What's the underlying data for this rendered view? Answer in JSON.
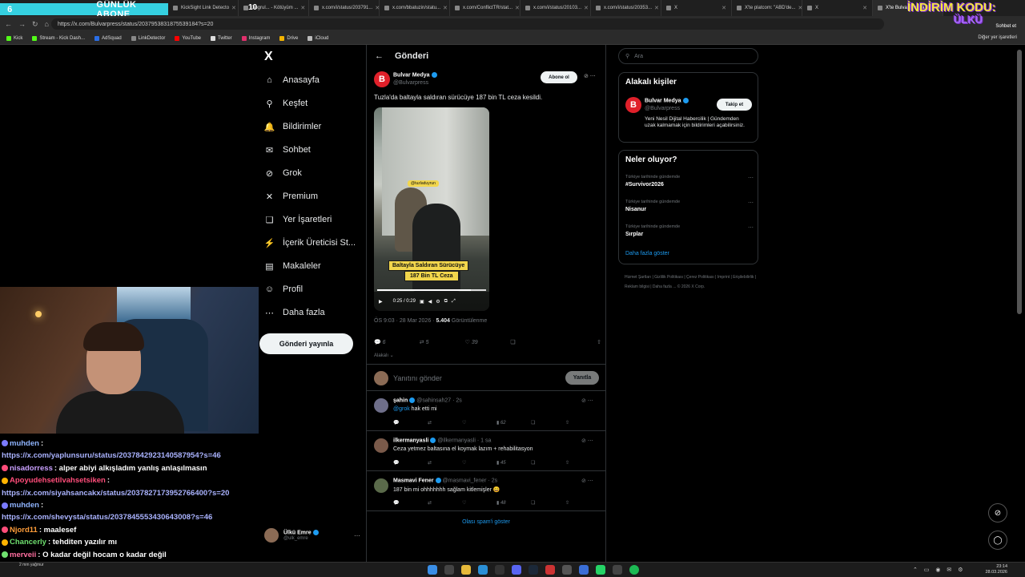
{
  "browser": {
    "tabs": [
      {
        "label": "KickSight Link Detecto",
        "active": false
      },
      {
        "label": "Dogrul... - Kötüyüm ...",
        "active": false
      },
      {
        "label": "x.com/i/status/203791...",
        "active": false
      },
      {
        "label": "x.com/bbatuzin/statu...",
        "active": false
      },
      {
        "label": "x.com/ConflictTR/stat...",
        "active": false
      },
      {
        "label": "x.com/i/status/20103...",
        "active": false
      },
      {
        "label": "x.com/i/status/20353...",
        "active": false
      },
      {
        "label": "X",
        "active": false
      },
      {
        "label": "X'te platcom: \"ABD'de...",
        "active": false
      },
      {
        "label": "X",
        "active": false
      },
      {
        "label": "X'te Bulvar Medya: \"T...",
        "active": true
      }
    ],
    "url": "https://x.com/Bulvarpress/status/2037953831875539184?s=20",
    "bookmarks": [
      "Kick",
      "Stream - Kick Dash...",
      "AdSquad",
      "LinkDetector",
      "YouTube",
      "Twitter",
      "Instagram",
      "Drive",
      "iCloud"
    ],
    "other_bookmarks": "Diğer yer işaretleri"
  },
  "overlay": {
    "counter_left": "6",
    "banner": "GÜNLÜK ABONE",
    "counter_right": "10",
    "promo_line1": "İNDİRİM KODU:",
    "promo_line2": "ÜLKÜ",
    "chat_label": "Sohbet et"
  },
  "nav": {
    "logo": "X",
    "items": [
      {
        "label": "Anasayfa",
        "icon": "home-icon",
        "glyph": "⌂"
      },
      {
        "label": "Keşfet",
        "icon": "search-icon",
        "glyph": "⚲"
      },
      {
        "label": "Bildirimler",
        "icon": "bell-icon",
        "glyph": "🔔"
      },
      {
        "label": "Sohbet",
        "icon": "mail-icon",
        "glyph": "✉"
      },
      {
        "label": "Grok",
        "icon": "grok-icon",
        "glyph": "⊘"
      },
      {
        "label": "Premium",
        "icon": "x-premium-icon",
        "glyph": "✕"
      },
      {
        "label": "Yer İşaretleri",
        "icon": "bookmark-icon",
        "glyph": "❏"
      },
      {
        "label": "İçerik Üreticisi St...",
        "icon": "lightning-icon",
        "glyph": "⚡"
      },
      {
        "label": "Makaleler",
        "icon": "article-icon",
        "glyph": "▤"
      },
      {
        "label": "Profil",
        "icon": "profile-icon",
        "glyph": "☺"
      },
      {
        "label": "Daha fazla",
        "icon": "more-icon",
        "glyph": "⋯"
      }
    ],
    "post_button": "Gönderi yayınla",
    "me": {
      "name": "Ülkü Emre",
      "handle": "@ulk_emre"
    }
  },
  "post": {
    "header": "Gönderi",
    "author_name": "Bulvar Medya",
    "author_handle": "@Bulvarpress",
    "subscribe": "Abone ol",
    "text": "Tuzla'da baltayla saldıran sürücüye 187 bin TL ceza kesildi.",
    "video": {
      "tag": "@tuzladuyrun",
      "caption1": "Baltayla Saldıran Sürücüye",
      "caption2": "187 Bin TL Ceza",
      "time": "0:25 / 0:29",
      "progress": 0.86
    },
    "time": "ÖS 9:03 · 28 Mar 2026 · ",
    "views": "5.404",
    "views_label": " Görüntülenme",
    "counts": {
      "replies": "6",
      "reposts": "5",
      "likes": "39"
    },
    "related": "Alakalı ⌄",
    "reply_placeholder": "Yanıtını gönder",
    "reply_button": "Yanıtla",
    "comments": [
      {
        "name": "şahin",
        "handle": "@sahinsah27 · 2s",
        "mention": "@grok",
        "text": " hak etti mi",
        "views": "62",
        "avatar": "#6f6f8a"
      },
      {
        "name": "ilkermanyasli",
        "handle": "@ilkermanyasli · 1 sa",
        "mention": "",
        "text": "Ceza yetmez baltasına el koymak lazım + rehabilitasyon",
        "views": "45",
        "avatar": "#7a5a4a"
      },
      {
        "name": "Masmavi Fener",
        "handle": "@masmavi_fener · 2s",
        "mention": "",
        "text": "187 bin mi ohhhhhhh sağlam kitlemişler 😄",
        "views": "48",
        "avatar": "#5a6a4a"
      }
    ],
    "show_spam": "Olası spam'i göster"
  },
  "sidebar": {
    "search_placeholder": "Ara",
    "related_title": "Alakalı kişiler",
    "person": {
      "name": "Bulvar Medya",
      "handle": "@Bulvarpress",
      "follow": "Takip et",
      "bio": "Yeni Nesil Dijital Habercilik | Gündemden uzak kalmamak için bildirimleri açabilirsiniz."
    },
    "trends_title": "Neler oluyor?",
    "trends": [
      {
        "context": "Türkiye tarihinde gündemde",
        "title": "#Survivor2026"
      },
      {
        "context": "Türkiye tarihinde gündemde",
        "title": "Nisanur"
      },
      {
        "context": "Türkiye tarihinde gündemde",
        "title": "Sırplar"
      }
    ],
    "show_more": "Daha fazla göster",
    "footer": "Hizmet Şartları  |  Gizlilik Politikası  |  Çerez Politikası  |  Imprint  |  Erişilebilirlik  |  Reklam bilgisi  |  Daha fazla ...  © 2026 X Corp."
  },
  "chat": [
    {
      "user": "muhden",
      "color": "#8fb4ff",
      "text": ":"
    },
    {
      "user": "",
      "color": "#aab3ff",
      "text": "https://x.com/yaplunsuru/status/2037842923140587954?s=46"
    },
    {
      "user": "nisadorress",
      "color": "#c9a0ff",
      "text": ": alper abiyi alkışladım yanlış anlaşılmasın"
    },
    {
      "user": "Apoyudehsetilvahsetsiken",
      "color": "#ff4d7a",
      "text": ":"
    },
    {
      "user": "",
      "color": "#aab3ff",
      "text": "https://x.com/siyahsancakx/status/2037827173952766400?s=20"
    },
    {
      "user": "muhden",
      "color": "#8fb4ff",
      "text": ":"
    },
    {
      "user": "",
      "color": "#aab3ff",
      "text": "https://x.com/shevysta/status/2037845553430643008?s=46"
    },
    {
      "user": "Njord11",
      "color": "#ff9d3a",
      "text": ": maalesef"
    },
    {
      "user": "Chancerly",
      "color": "#6fe06f",
      "text": ": tehditen yazılır mı"
    },
    {
      "user": "merveii",
      "color": "#ff6fa0",
      "text": ": O kadar değil hocam o kadar değil"
    }
  ],
  "taskbar": {
    "weather": "2 mm yağmur",
    "time": "23:14",
    "date": "28.03.2026"
  }
}
